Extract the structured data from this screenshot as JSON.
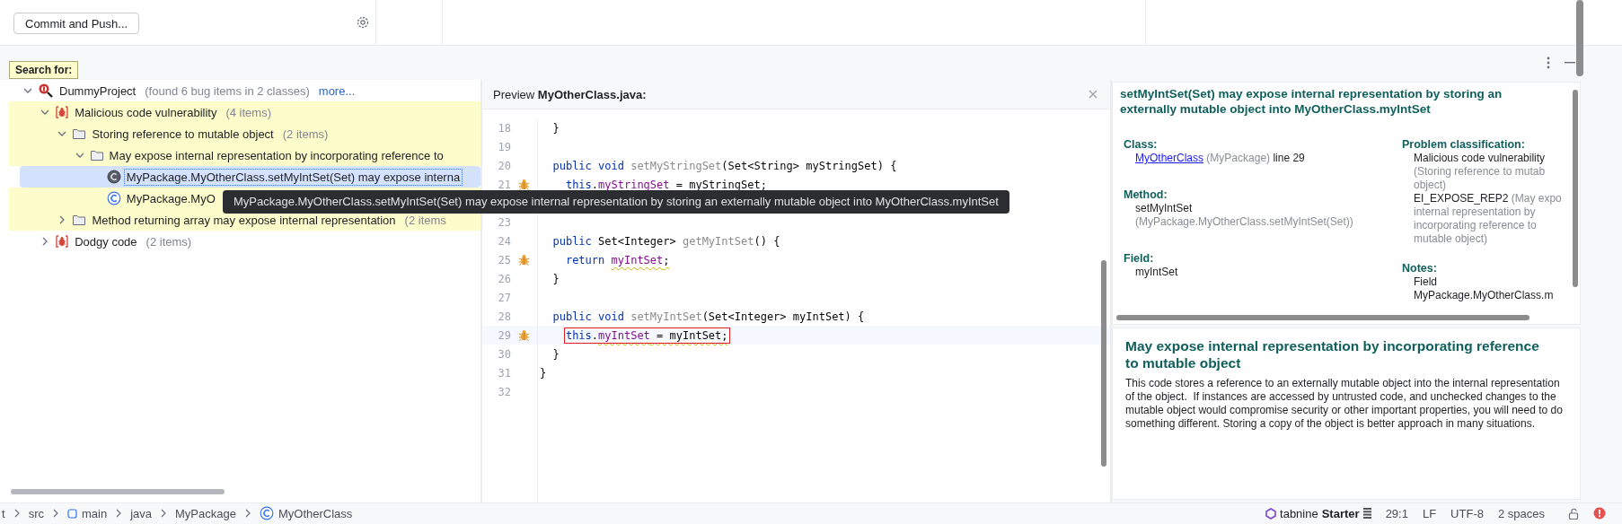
{
  "toolbar": {
    "commit_button": "Commit and Push..."
  },
  "search_label": "Search for:",
  "tree": {
    "items": [
      {
        "kind": "project",
        "label": "DummyProject",
        "count": "(found 6 bug items in 2 classes)",
        "link": "more...",
        "expanded": true,
        "selected": false,
        "highlighted": false,
        "children": [
          {
            "kind": "category",
            "label": "Malicious code vulnerability",
            "count": "(4 items)",
            "expanded": true,
            "selected": false,
            "highlighted": true,
            "children": [
              {
                "kind": "group",
                "label": "Storing reference to mutable object",
                "count": "(2 items)",
                "expanded": true,
                "selected": false,
                "highlighted": true,
                "children": [
                  {
                    "kind": "group",
                    "label": "May expose internal representation by incorporating reference to",
                    "expanded": true,
                    "selected": false,
                    "highlighted": true,
                    "children": [
                      {
                        "kind": "bug",
                        "label": "MyPackage.MyOtherClass.setMyIntSet(Set) may expose interna",
                        "selected": true,
                        "highlighted": true
                      },
                      {
                        "kind": "bug",
                        "label": "MyPackage.MyO",
                        "selected": false,
                        "highlighted": true
                      }
                    ]
                  }
                ]
              },
              {
                "kind": "group",
                "label": "Method returning array may expose internal representation",
                "count": "(2 items",
                "expanded": false,
                "selected": false,
                "highlighted": true
              }
            ]
          },
          {
            "kind": "category",
            "label": "Dodgy code",
            "count": "(2 items)",
            "expanded": false,
            "selected": false,
            "highlighted": false
          }
        ]
      }
    ]
  },
  "code": {
    "header": "Preview **MyOtherClass.java:**",
    "lines": [
      {
        "number": "18",
        "tokens": [
          {
            "kind": "plain",
            "text": "  }"
          }
        ]
      },
      {
        "number": "19"
      },
      {
        "number": "20",
        "tokens": [
          {
            "kind": "keyword",
            "text": "  public void "
          },
          {
            "kind": "unused",
            "text": "setMyStringSet"
          },
          {
            "kind": "plain",
            "text": "(Set<String> myStringSet) {"
          }
        ]
      },
      {
        "number": "21",
        "bug": true,
        "tokens": [
          {
            "kind": "keyword",
            "text": "    this"
          },
          {
            "kind": "plain",
            "text": "."
          },
          {
            "kind": "field",
            "text": "myStringSet"
          },
          {
            "kind": "plain",
            "text": " = myStringSet;"
          }
        ]
      },
      {
        "number": "23"
      },
      {
        "number": "24",
        "tokens": [
          {
            "kind": "keyword",
            "text": "  public"
          },
          {
            "kind": "plain",
            "text": " Set<Integer> "
          },
          {
            "kind": "unused",
            "text": "getMyIntSet"
          },
          {
            "kind": "plain",
            "text": "() {"
          }
        ]
      },
      {
        "number": "25",
        "bug": true,
        "tokens": [
          {
            "kind": "keyword",
            "text": "    return "
          },
          {
            "kind": "field",
            "text": "myIntSet",
            "warn": true
          },
          {
            "kind": "plain",
            "text": ";",
            "warn": true
          }
        ]
      },
      {
        "number": "26",
        "tokens": [
          {
            "kind": "plain",
            "text": "  }"
          }
        ]
      },
      {
        "number": "27"
      },
      {
        "number": "28",
        "tokens": [
          {
            "kind": "keyword",
            "text": "  public void "
          },
          {
            "kind": "unused",
            "text": "setMyIntSet"
          },
          {
            "kind": "plain",
            "text": "(Set<Integer> myIntSet) {"
          }
        ]
      },
      {
        "number": "29",
        "bug": true,
        "current": true,
        "tokens": [
          {
            "kind": "keyword",
            "text": "    this",
            "boxed": true
          },
          {
            "kind": "plain",
            "text": ".",
            "boxed": true
          },
          {
            "kind": "field",
            "text": "myIntSet",
            "warn": true,
            "boxed": true
          },
          {
            "kind": "plain",
            "text": " = myIntSet;",
            "warn": true,
            "boxed": true
          }
        ]
      },
      {
        "number": "30",
        "tokens": [
          {
            "kind": "plain",
            "text": "  }"
          }
        ]
      },
      {
        "number": "31",
        "tokens": [
          {
            "kind": "plain",
            "text": "}"
          }
        ]
      },
      {
        "number": "32"
      }
    ]
  },
  "tooltip": "MyPackage.MyOtherClass.setMyIntSet(Set) may expose internal representation by storing an externally mutable object into MyOtherClass.myIntSet",
  "details": {
    "title": "setMyIntSet(Set) may expose internal representation by storing an externally mutable object into MyOtherClass.myIntSet",
    "class": {
      "label": "Class:",
      "link": "MyOtherClass",
      "package": "(MyPackage)",
      "line": "line 29"
    },
    "method": {
      "label": "Method:",
      "name": "setMyIntSet",
      "signature": "(MyPackage.MyOtherClass.setMyIntSet(Set))"
    },
    "field": {
      "label": "Field:",
      "name": "myIntSet"
    },
    "classification": {
      "label": "Problem classification:",
      "category": "Malicious code vulnerability",
      "category_detail": [
        "(Storing reference to mutab",
        "object)"
      ],
      "pattern": "EI_EXPOSE_REP2",
      "pattern_detail": [
        "(May expo",
        "internal representation by",
        "incorporating reference to",
        "mutable object)"
      ]
    },
    "notes": {
      "label": "Notes:",
      "lines": [
        "Field",
        "MyPackage.MyOtherClass.m"
      ]
    }
  },
  "description": {
    "title": "May expose internal representation by incorporating reference to mutable object",
    "text": "This code stores a reference to an externally mutable object into the internal representation of the object.  If instances are accessed by untrusted code, and unchecked changes to the mutable object would compromise security or other important properties, you will need to do something different. Storing a copy of the object is better approach in many situations."
  },
  "status_bar": {
    "breadcrumbs": [
      {
        "label": "t",
        "kind": "directory"
      },
      {
        "label": "src",
        "kind": "directory"
      },
      {
        "label": "main",
        "kind": "module"
      },
      {
        "label": "java",
        "kind": "directory"
      },
      {
        "label": "MyPackage",
        "kind": "directory"
      },
      {
        "label": "MyOtherClass",
        "kind": "class"
      }
    ],
    "plugin": {
      "name": "tabnine",
      "plan": "Starter"
    },
    "position": "29:1",
    "line_separator": "LF",
    "encoding": "UTF-8",
    "indent": "2 spaces"
  }
}
